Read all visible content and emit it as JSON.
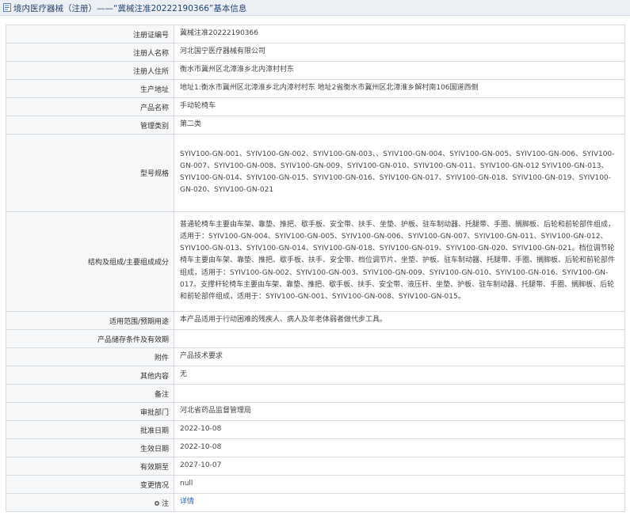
{
  "header": {
    "title": "境内医疗器械（注册）——“冀械注准20222190366”基本信息"
  },
  "rows": [
    {
      "label": "注册证编号",
      "value": "冀械注准20222190366"
    },
    {
      "label": "注册人名称",
      "value": "河北国宁医疗器械有限公司"
    },
    {
      "label": "注册人住所",
      "value": "衡水市冀州区北漳淮乡北内漳村村东"
    },
    {
      "label": "生产地址",
      "value": "地址1:衡水市冀州区北漳淮乡北内漳村村东 地址2省衡水市冀州区北漳淮乡解村南106国道西侧"
    },
    {
      "label": "产品名称",
      "value": "手动轮椅车"
    },
    {
      "label": "管理类别",
      "value": "第二类"
    },
    {
      "label": "型号规格",
      "value": "SYIV100-GN-001、SYIV100-GN-002、SYIV100-GN-003、、SYIV100-GN-004、SYIV100-GN-005、SYIV100-GN-006、SYIV100-GN-007、SYIV100-GN-008、SYIV100-GN-009、SYIV100-GN-010、SYIV100-GN-011、SYIV100-GN-012 SYIV100-GN-013、SYIV100-GN-014、SYIV100-GN-015、SYIV100-GN-016、SYIV100-GN-017、SYIV100-GN-018、SYIV100-GN-019、SYIV100-GN-020、SYIV100-GN-021"
    },
    {
      "label": "结构及组成/主要组成成分",
      "value": "普通轮椅车主要由车架、靠垫、推把、歇手板、安全带、扶手、坐垫、护板、驻车制动器、托腿带、手圈、搁脚板、后轮和前轮部件组成，适用于：SYIV100-GN-004、SYIV100-GN-005、SYIV100-GN-006、SYIV100-GN-007、SYIV100-GN-011、SYIV100-GN-012、SYIV100-GN-013、SYIV100-GN-014、SYIV100-GN-018、SYIV100-GN-019、SYIV100-GN-020、SYIV100-GN-021。档位调节轮椅车主要由车架、靠垫、推把、歇手板、扶手、安全带、档位调节片、坐垫、护板、驻车制动器、托腿带、手圈、搁脚板、后轮和前轮部件组成，适用于：SYIV100-GN-002、SYIV100-GN-003、SYIV100-GN-009、SYIV100-GN-010、SYIV100-GN-016、SYIV100-GN-017。支撑杆轮椅车主要由车架、靠垫、推把、歇手板、扶手、安全带、液压杆、坐垫、护板、驻车制动器、托腿带、手圈、搁脚板、后轮和前轮部件组成，适用于：SYIV100-GN-001、SYIV100-GN-008、SYIV100-GN-015。"
    },
    {
      "label": "适用范围/预期用途",
      "value": "本产品适用于行动困难的残疾人、病人及年老体弱者做代步工具。"
    },
    {
      "label": "产品储存条件及有效期",
      "value": ""
    },
    {
      "label": "附件",
      "value": "产品技术要求"
    },
    {
      "label": "其他内容",
      "value": "无"
    },
    {
      "label": "备注",
      "value": ""
    },
    {
      "label": "审批部门",
      "value": "河北省药品监督管理局"
    },
    {
      "label": "批准日期",
      "value": "2022-10-08"
    },
    {
      "label": "生效日期",
      "value": "2022-10-08"
    },
    {
      "label": "有效期至",
      "value": "2027-10-07"
    },
    {
      "label": "变更情况",
      "value": "null"
    },
    {
      "label": "注",
      "value": "详情"
    }
  ]
}
